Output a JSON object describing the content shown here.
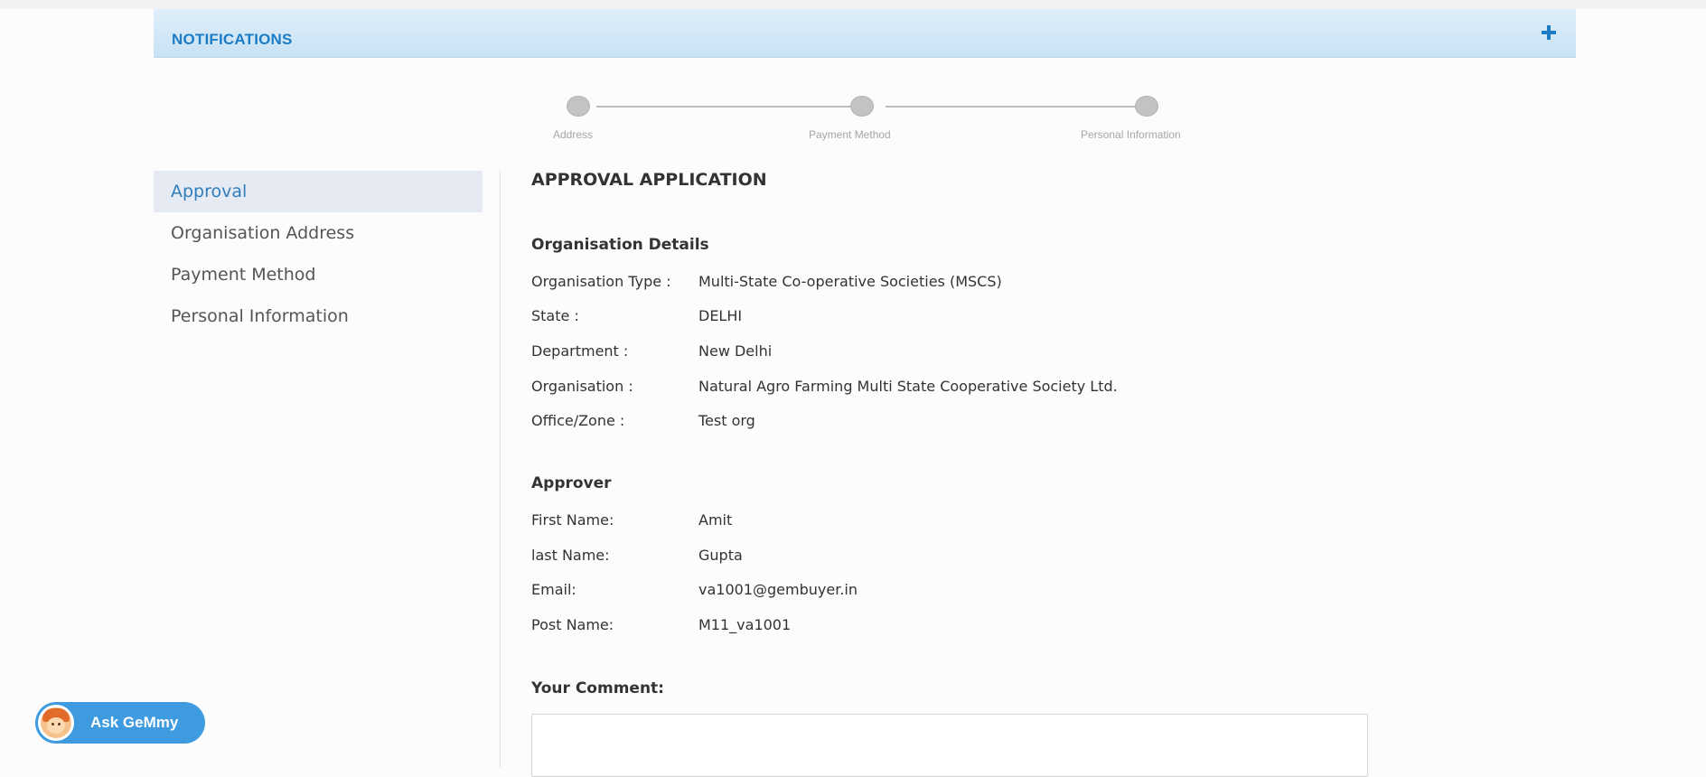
{
  "notifications": {
    "title": "NOTIFICATIONS",
    "expand_icon": "plus-icon"
  },
  "stepper": {
    "steps": [
      {
        "label": "Address"
      },
      {
        "label": "Payment Method"
      },
      {
        "label": "Personal Information"
      }
    ]
  },
  "sidebar": {
    "items": [
      {
        "label": "Approval",
        "active": true
      },
      {
        "label": "Organisation Address",
        "active": false
      },
      {
        "label": "Payment Method",
        "active": false
      },
      {
        "label": "Personal Information",
        "active": false
      }
    ]
  },
  "main": {
    "heading": "APPROVAL APPLICATION",
    "org_details": {
      "title": "Organisation Details",
      "rows": [
        {
          "label": "Organisation Type :",
          "value": "Multi-State Co-operative Societies (MSCS)"
        },
        {
          "label": "State :",
          "value": "DELHI"
        },
        {
          "label": "Department :",
          "value": "New Delhi"
        },
        {
          "label": "Organisation :",
          "value": "Natural Agro Farming Multi State Cooperative Society Ltd."
        },
        {
          "label": "Office/Zone :",
          "value": "Test org"
        }
      ]
    },
    "approver": {
      "title": "Approver",
      "rows": [
        {
          "label": "First Name:",
          "value": "Amit"
        },
        {
          "label": "last Name:",
          "value": "Gupta"
        },
        {
          "label": "Email:",
          "value": "va1001@gembuyer.in"
        },
        {
          "label": "Post Name:",
          "value": "M11_va1001"
        }
      ]
    },
    "comment": {
      "label": "Your Comment:",
      "value": ""
    }
  },
  "assistant": {
    "label": "Ask GeMmy",
    "icon": "assistant-avatar-icon"
  },
  "colors": {
    "accent": "#1c7cc6",
    "notif_bg": "#d4e8f7",
    "active_nav_bg": "#e6ebf3",
    "assistant_bg": "#3e9be0"
  }
}
